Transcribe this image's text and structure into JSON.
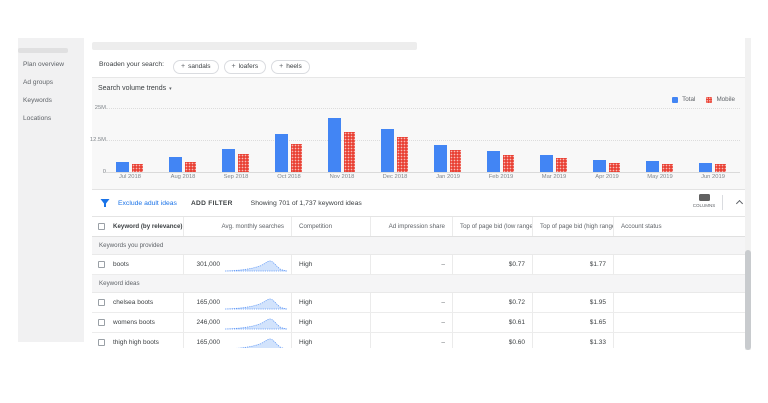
{
  "sidebar": {
    "items": [
      {
        "label": "Plan overview"
      },
      {
        "label": "Ad groups"
      },
      {
        "label": "Keywords"
      },
      {
        "label": "Locations"
      }
    ]
  },
  "broaden": {
    "label": "Broaden your search:",
    "chips": [
      {
        "label": "sandals"
      },
      {
        "label": "loafers"
      },
      {
        "label": "heels"
      }
    ]
  },
  "icons": {
    "plus": "+",
    "caret_down": "▾",
    "sort_desc": "↓"
  },
  "chart_data": {
    "type": "bar",
    "title": "Search volume trends",
    "categories": [
      "Jul 2018",
      "Aug 2018",
      "Sep 2018",
      "Oct 2018",
      "Nov 2018",
      "Dec 2018",
      "Jan 2019",
      "Feb 2019",
      "Mar 2019",
      "Apr 2019",
      "May 2019",
      "Jun 2019"
    ],
    "series": [
      {
        "name": "Total",
        "color": "#4285f4",
        "values": [
          4.0,
          5.8,
          9.0,
          14.7,
          21.0,
          16.8,
          10.6,
          8.1,
          6.7,
          4.6,
          4.2,
          3.7
        ]
      },
      {
        "name": "Mobile",
        "color": "#ea4335",
        "values": [
          3.0,
          4.0,
          6.9,
          11.0,
          15.7,
          13.5,
          8.5,
          6.5,
          5.6,
          3.7,
          3.3,
          3.0
        ]
      }
    ],
    "unit": "millions",
    "ylim": [
      0,
      25
    ],
    "yticks": [
      "25M",
      "12.5M",
      "0"
    ],
    "grid": true,
    "legend_position": "top-right"
  },
  "filter_bar": {
    "exclude_link": "Exclude adult ideas",
    "add_filter": "ADD FILTER",
    "showing": "Showing 701 of 1,737 keyword ideas",
    "columns_label": "COLUMNS"
  },
  "table": {
    "columns": [
      "Keyword (by relevance)",
      "Avg. monthly searches",
      "Competition",
      "Ad impression share",
      "Top of page bid (low range)",
      "Top of page bid (high range)",
      "Account status"
    ],
    "sections": [
      {
        "label": "Keywords you provided",
        "rows": [
          {
            "keyword": "boots",
            "avg_monthly_searches": "301,000",
            "competition": "High",
            "ad_impression_share": "–",
            "top_bid_low": "$0.77",
            "top_bid_high": "$1.77",
            "account_status": ""
          }
        ]
      },
      {
        "label": "Keyword ideas",
        "rows": [
          {
            "keyword": "chelsea boots",
            "avg_monthly_searches": "165,000",
            "competition": "High",
            "ad_impression_share": "–",
            "top_bid_low": "$0.72",
            "top_bid_high": "$1.95",
            "account_status": ""
          },
          {
            "keyword": "womens boots",
            "avg_monthly_searches": "246,000",
            "competition": "High",
            "ad_impression_share": "–",
            "top_bid_low": "$0.61",
            "top_bid_high": "$1.65",
            "account_status": ""
          },
          {
            "keyword": "thigh high boots",
            "avg_monthly_searches": "165,000",
            "competition": "High",
            "ad_impression_share": "–",
            "top_bid_low": "$0.60",
            "top_bid_high": "$1.33",
            "account_status": ""
          }
        ]
      }
    ]
  }
}
